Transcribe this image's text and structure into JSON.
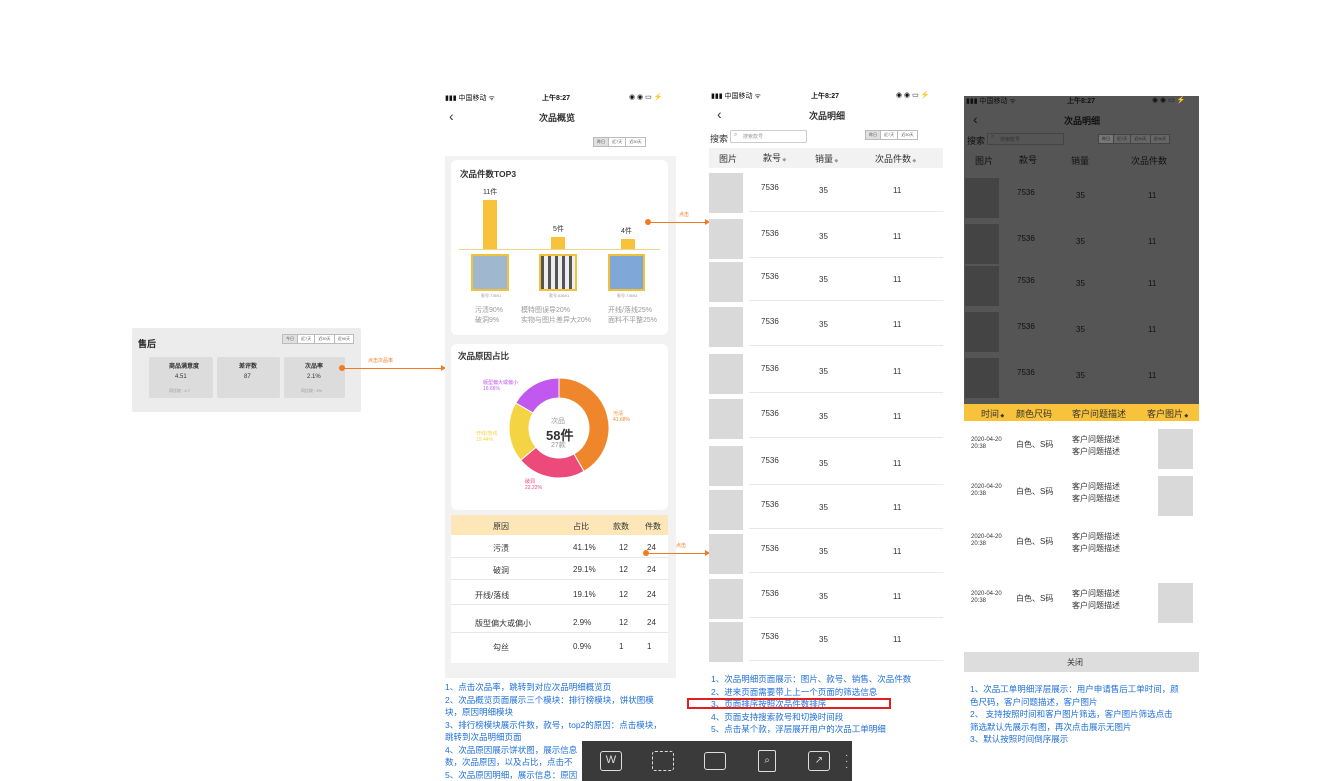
{
  "aftersales": {
    "title": "售后",
    "tabs": [
      "今日",
      "近7天",
      "近30天",
      "近90天"
    ],
    "metrics": [
      {
        "label": "商品满意度",
        "value": "4.51",
        "sub": "同比较 : 4.7"
      },
      {
        "label": "差评数",
        "value": "87",
        "sub": ""
      },
      {
        "label": "次品率",
        "value": "2.1%",
        "sub": "同比较 : 2%"
      }
    ]
  },
  "arrows": {
    "click_rate": "点击次品率",
    "click": "点击"
  },
  "overview": {
    "carrier": "中国移动",
    "time": "上午8:27",
    "title": "次品概览",
    "tabs": [
      "昨日",
      "近7天",
      "近30天"
    ],
    "top3": {
      "title": "次品件数TOP3",
      "items": [
        {
          "count": "11件",
          "code": "款号:73691",
          "r1": "污渍90%",
          "r2": "破洞9%"
        },
        {
          "count": "5件",
          "code": "款号:83691",
          "r1": "模特图误导20%",
          "r2": "实物与图片差异大20%"
        },
        {
          "count": "4件",
          "code": "款号:73693",
          "r1": "开线/落线25%",
          "r2": "面料不平整25%"
        }
      ]
    },
    "reasons": {
      "title": "次品原因占比",
      "center_label": "次品",
      "center_value": "58件",
      "center_sub": "27款",
      "slices": [
        {
          "label": "污渍",
          "pct": "41.68%",
          "value": 41.68,
          "color": "#f0862b"
        },
        {
          "label": "破洞",
          "pct": "22.22%",
          "value": 22.22,
          "color": "#ec4a7b"
        },
        {
          "label": "开线/落线",
          "pct": "19.44%",
          "value": 19.44,
          "color": "#f4d442"
        },
        {
          "label": "版型偏大或偏小",
          "pct": "16.66%",
          "value": 16.66,
          "color": "#c158f0"
        }
      ]
    },
    "table": {
      "headers": [
        "原因",
        "占比",
        "款数",
        "件数"
      ],
      "rows": [
        [
          "污渍",
          "41.1%",
          "12",
          "24"
        ],
        [
          "破洞",
          "29.1%",
          "12",
          "24"
        ],
        [
          "开线/落线",
          "19.1%",
          "12",
          "24"
        ],
        [
          "版型偏大或偏小",
          "2.9%",
          "12",
          "24"
        ],
        [
          "勾丝",
          "0.9%",
          "1",
          "1"
        ]
      ]
    }
  },
  "overview_notes": [
    "1、点击次品率，跳转到对应次品明细概览页",
    "2、次品概览页面展示三个模块：排行榜模块，饼状图模",
    "块，原因明细模块",
    "3、排行榜模块展示件数，款号，top2的原因：点击模块，",
    "跳转到次品明细页面",
    "4、次品原因展示饼状图，展示信息",
    "数，次品原因，以及占比，点击不",
    "5、次品原因明细，展示信息：原因"
  ],
  "detail": {
    "carrier": "中国移动",
    "time": "上午8:27",
    "title": "次品明细",
    "search_label": "搜索",
    "search_placeholder": "搜索款号",
    "tabs": [
      "昨日",
      "近7天",
      "近30天"
    ],
    "headers": [
      "图片",
      "款号",
      "销量",
      "次品件数"
    ],
    "rows": [
      [
        "7536",
        "35",
        "11"
      ],
      [
        "7536",
        "35",
        "11"
      ],
      [
        "7536",
        "35",
        "11"
      ],
      [
        "7536",
        "35",
        "11"
      ],
      [
        "7536",
        "35",
        "11"
      ],
      [
        "7536",
        "35",
        "11"
      ],
      [
        "7536",
        "35",
        "11"
      ],
      [
        "7536",
        "35",
        "11"
      ],
      [
        "7536",
        "35",
        "11"
      ],
      [
        "7536",
        "35",
        "11"
      ],
      [
        "7536",
        "35",
        "11"
      ]
    ]
  },
  "detail_notes": [
    "1、次品明细页面展示：图片、款号、销售、次品件数",
    "2、进来页面需要带上上一个页面的筛选信息",
    "3、页面排序按照次品件数排序",
    "4、页面支持搜索款号和切换时间段",
    "5、点击某个款，浮层展开用户的次品工单明细"
  ],
  "workorder": {
    "carrier": "中国移动",
    "time": "上午8:27",
    "title": "次品明细",
    "search_label": "搜索",
    "search_placeholder": "搜索款号",
    "tabs": [
      "昨日",
      "近7天",
      "近30天",
      "近90天"
    ],
    "headers": [
      "图片",
      "款号",
      "销量",
      "次品件数"
    ],
    "rows": [
      [
        "7536",
        "35",
        "11"
      ],
      [
        "7536",
        "35",
        "11"
      ],
      [
        "7536",
        "35",
        "11"
      ],
      [
        "7536",
        "35",
        "11"
      ],
      [
        "7536",
        "35",
        "11"
      ]
    ],
    "layer_headers": [
      "时间",
      "颜色尺码",
      "客户问题描述",
      "客户图片"
    ],
    "layer_rows": [
      {
        "date": "2020-04-20",
        "time": "20:38",
        "spec": "白色、S码",
        "desc1": "客户问题描述",
        "desc2": "客户问题描述",
        "img": true
      },
      {
        "date": "2020-04-20",
        "time": "20:38",
        "spec": "白色、S码",
        "desc1": "客户问题描述",
        "desc2": "客户问题描述",
        "img": true
      },
      {
        "date": "2020-04-20",
        "time": "20:38",
        "spec": "白色、S码",
        "desc1": "客户问题描述",
        "desc2": "客户问题描述",
        "img": false
      },
      {
        "date": "2020-04-20",
        "time": "20:38",
        "spec": "白色、S码",
        "desc1": "客户问题描述",
        "desc2": "客户问题描述",
        "img": true
      }
    ],
    "close": "关闭"
  },
  "workorder_notes": [
    "1、次品工单明细浮层展示：用户申请售后工单时间，颜",
    "色尺码，客户问题描述，客户图片",
    "2、 支持按照时间和客户图片筛选，客户图片筛选点击",
    "筛选默认先展示有图，再次点击展示无图片",
    "3、默认按照时间倒序展示"
  ],
  "toolbar": {
    "icons": [
      "text-recognize-icon",
      "scan-icon",
      "print-icon",
      "file-search-icon",
      "copy-icon",
      "more-icon"
    ]
  },
  "colors": {
    "accent": "#f27b21",
    "note": "#1e6fd9",
    "highlight": "#fde7b8",
    "overlay": "#555555"
  }
}
